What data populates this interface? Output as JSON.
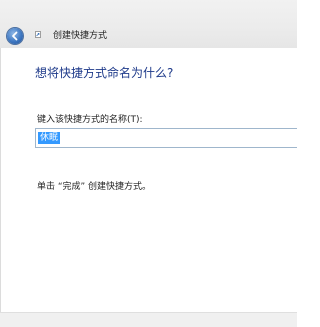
{
  "window": {
    "title": "创建快捷方式"
  },
  "wizard": {
    "heading": "想将快捷方式命名为什么?",
    "name_label": "键入该快捷方式的名称(T):",
    "name_value": "休眠",
    "hint": "单击 “完成” 创建快捷方式。"
  },
  "colors": {
    "heading": "#1e3a8a",
    "selection": "#3399ff"
  },
  "icons": {
    "back": "back-arrow-icon",
    "shortcut": "shortcut-icon"
  }
}
